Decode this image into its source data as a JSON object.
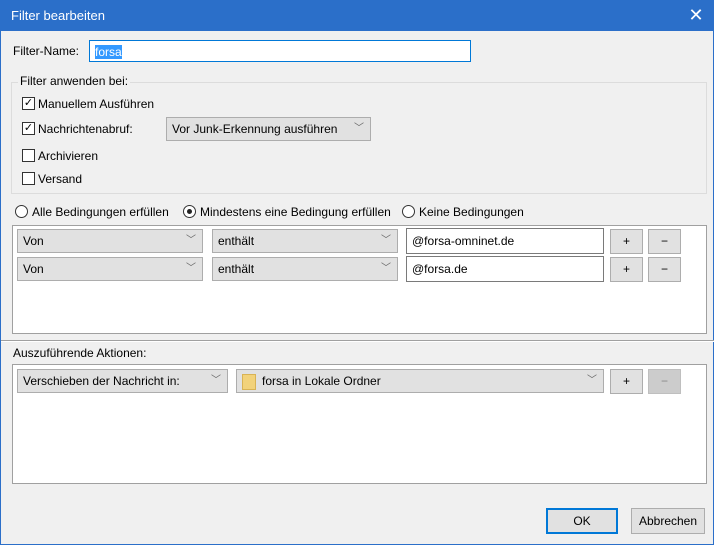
{
  "window": {
    "title": "Filter bearbeiten",
    "close": "✕"
  },
  "filter_name": {
    "label": "Filter-Name:",
    "value": "forsa"
  },
  "apply": {
    "legend": "Filter anwenden bei:",
    "items": [
      {
        "label": "Manuellem Ausführen",
        "checked": true
      },
      {
        "label": "Nachrichtenabruf:",
        "checked": true
      },
      {
        "label": "Archivieren",
        "checked": false
      },
      {
        "label": "Versand",
        "checked": false
      }
    ],
    "timing": "Vor Junk-Erkennung ausführen"
  },
  "match": {
    "options": [
      "Alle Bedingungen erfüllen",
      "Mindestens eine Bedingung erfüllen",
      "Keine Bedingungen"
    ],
    "selected": 1
  },
  "conditions": [
    {
      "field": "Von",
      "op": "enthält",
      "value": "@forsa-omninet.de"
    },
    {
      "field": "Von",
      "op": "enthält",
      "value": "@forsa.de"
    }
  ],
  "actions": {
    "label": "Auszuführende Aktionen:",
    "rows": [
      {
        "action": "Verschieben der Nachricht in:",
        "target": "forsa in Lokale Ordner"
      }
    ]
  },
  "buttons": {
    "plus": "+",
    "minus": "−",
    "ok": "OK",
    "cancel": "Abbrechen"
  }
}
